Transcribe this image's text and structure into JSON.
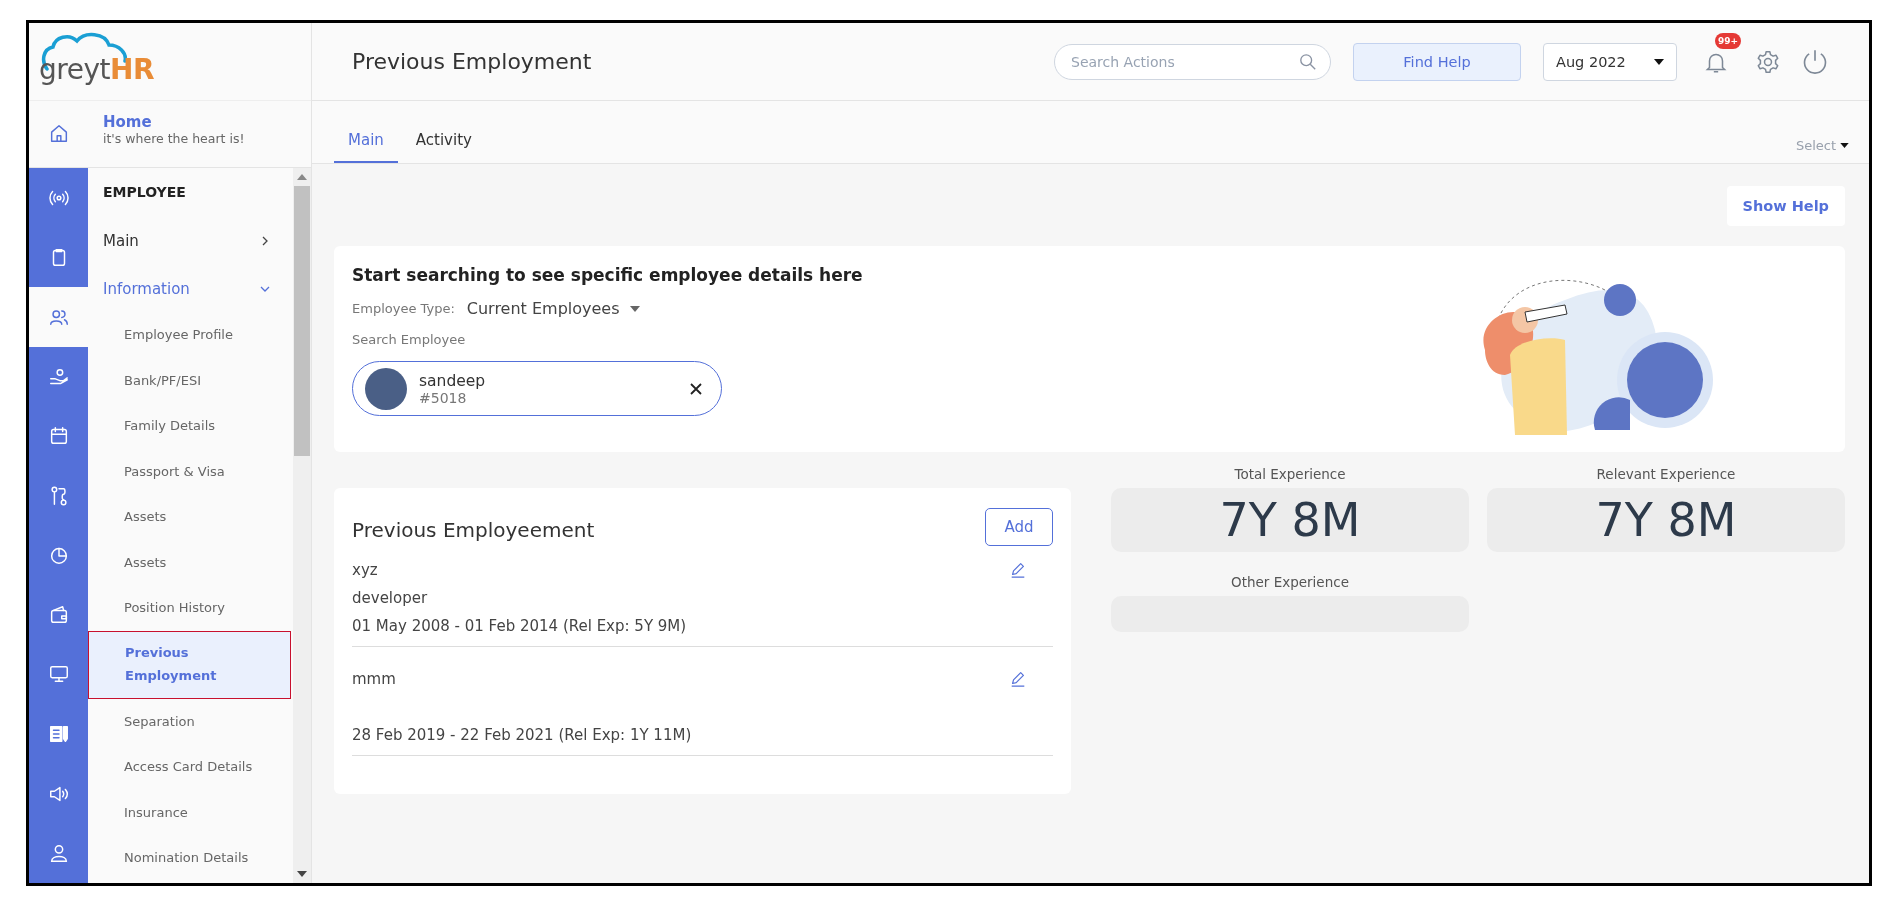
{
  "header": {
    "logo": {
      "text": "greyt",
      "accent": "HR"
    },
    "title": "Previous Employment",
    "search": {
      "placeholder": "Search Actions"
    },
    "find_help": "Find Help",
    "period": "Aug 2022",
    "notifications": "99+"
  },
  "home": {
    "title": "Home",
    "subtitle": "it's where the heart is!"
  },
  "rail": [
    {
      "selected": false
    },
    {
      "selected": false
    },
    {
      "selected": true
    },
    {
      "selected": false
    },
    {
      "selected": false
    },
    {
      "selected": false
    },
    {
      "selected": false
    },
    {
      "selected": false
    },
    {
      "selected": false
    },
    {
      "selected": false
    },
    {
      "selected": false
    }
  ],
  "sidebar": {
    "section": "EMPLOYEE",
    "groups": [
      {
        "label": "Main",
        "expanded": false
      },
      {
        "label": "Information",
        "expanded": true,
        "children": [
          {
            "label": "Employee Profile",
            "selected": false
          },
          {
            "label": "Bank/PF/ESI",
            "selected": false
          },
          {
            "label": "Family Details",
            "selected": false
          },
          {
            "label": "Passport & Visa",
            "selected": false
          },
          {
            "label": "Assets",
            "selected": false
          },
          {
            "label": "Assets",
            "selected": false
          },
          {
            "label": "Position History",
            "selected": false
          },
          {
            "label": "Previous Employment",
            "selected": true
          },
          {
            "label": "Separation",
            "selected": false
          },
          {
            "label": "Access Card Details",
            "selected": false
          },
          {
            "label": "Insurance",
            "selected": false
          },
          {
            "label": "Nomination Details",
            "selected": false
          }
        ]
      }
    ]
  },
  "tabs": [
    {
      "label": "Main",
      "selected": true
    },
    {
      "label": "Activity",
      "selected": false
    }
  ],
  "select": "Select",
  "show_help": "Show Help",
  "search_card": {
    "title": "Start searching to see specific employee details here",
    "type_label": "Employee Type:",
    "type_value": "Current Employees",
    "search_label": "Search Employee",
    "employee": {
      "name": "sandeep",
      "id": "#5018"
    }
  },
  "employment": {
    "title": "Previous Employeement",
    "add": "Add",
    "entries": [
      {
        "company": "xyz",
        "role": "developer",
        "period": "01 May 2008 - 01 Feb 2014 (Rel Exp: 5Y 9M)"
      },
      {
        "company": "mmm",
        "period": "28 Feb 2019 - 22 Feb 2021 (Rel Exp: 1Y 11M)"
      }
    ]
  },
  "experience": [
    {
      "label": "Total Experience",
      "value": "7Y 8M"
    },
    {
      "label": "Relevant Experience",
      "value": "7Y 8M"
    },
    {
      "label": "Other Experience"
    }
  ]
}
